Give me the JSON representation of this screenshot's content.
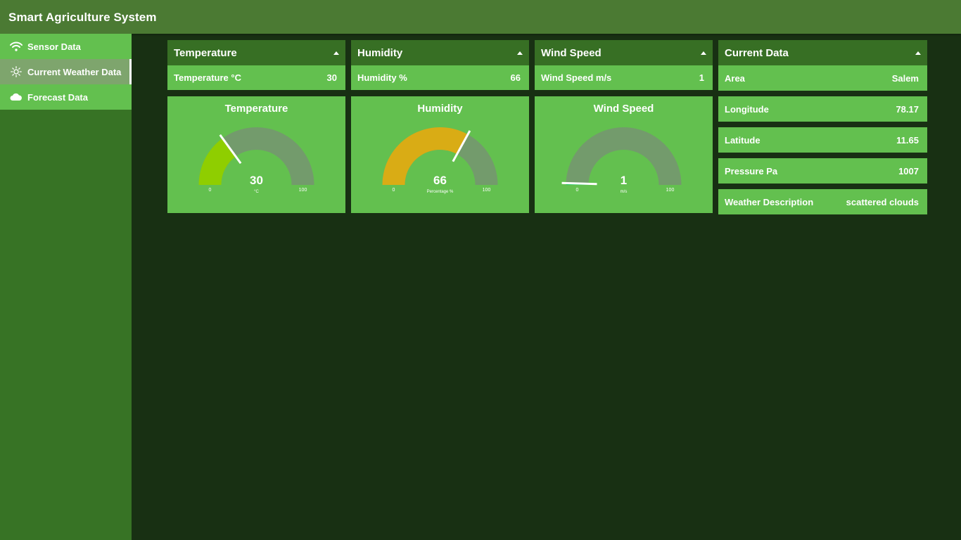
{
  "app": {
    "title": "Smart Agriculture System"
  },
  "sidebar": {
    "items": [
      {
        "label": "Sensor Data",
        "icon": "wifi-icon"
      },
      {
        "label": "Current Weather Data",
        "icon": "sun-icon"
      },
      {
        "label": "Forecast Data",
        "icon": "cloud-icon"
      }
    ]
  },
  "colors": {
    "topbar": "#4b7a33",
    "sidebar": "#377325",
    "accent_green": "#63c04f",
    "panel_header": "#376f24",
    "background": "#183013",
    "gauge_track": "#739b6c",
    "temp_fill": "#8fce00",
    "humidity_fill": "#d9ac15",
    "wind_fill": "#22c55e"
  },
  "panels": {
    "temperature": {
      "header": "Temperature",
      "row_label": "Temperature °C",
      "row_value": "30",
      "gauge": {
        "title": "Temperature",
        "value": "30",
        "unit": "°C",
        "min": "0",
        "max": "100",
        "fraction": 0.3
      }
    },
    "humidity": {
      "header": "Humidity",
      "row_label": "Humidity %",
      "row_value": "66",
      "gauge": {
        "title": "Humidity",
        "value": "66",
        "unit": "Percentage %",
        "min": "0",
        "max": "100",
        "fraction": 0.66
      }
    },
    "wind": {
      "header": "Wind Speed",
      "row_label": "Wind Speed m/s",
      "row_value": "1",
      "gauge": {
        "title": "Wind Speed",
        "value": "1",
        "unit": "m/s",
        "min": "0",
        "max": "100",
        "fraction": 0.01
      }
    },
    "current": {
      "header": "Current Data",
      "rows": [
        {
          "label": "Area",
          "value": "Salem"
        },
        {
          "label": "Longitude",
          "value": "78.17"
        },
        {
          "label": "Latitude",
          "value": "11.65"
        },
        {
          "label": "Pressure Pa",
          "value": "1007"
        },
        {
          "label": "Weather Description",
          "value": "scattered clouds"
        }
      ]
    }
  }
}
